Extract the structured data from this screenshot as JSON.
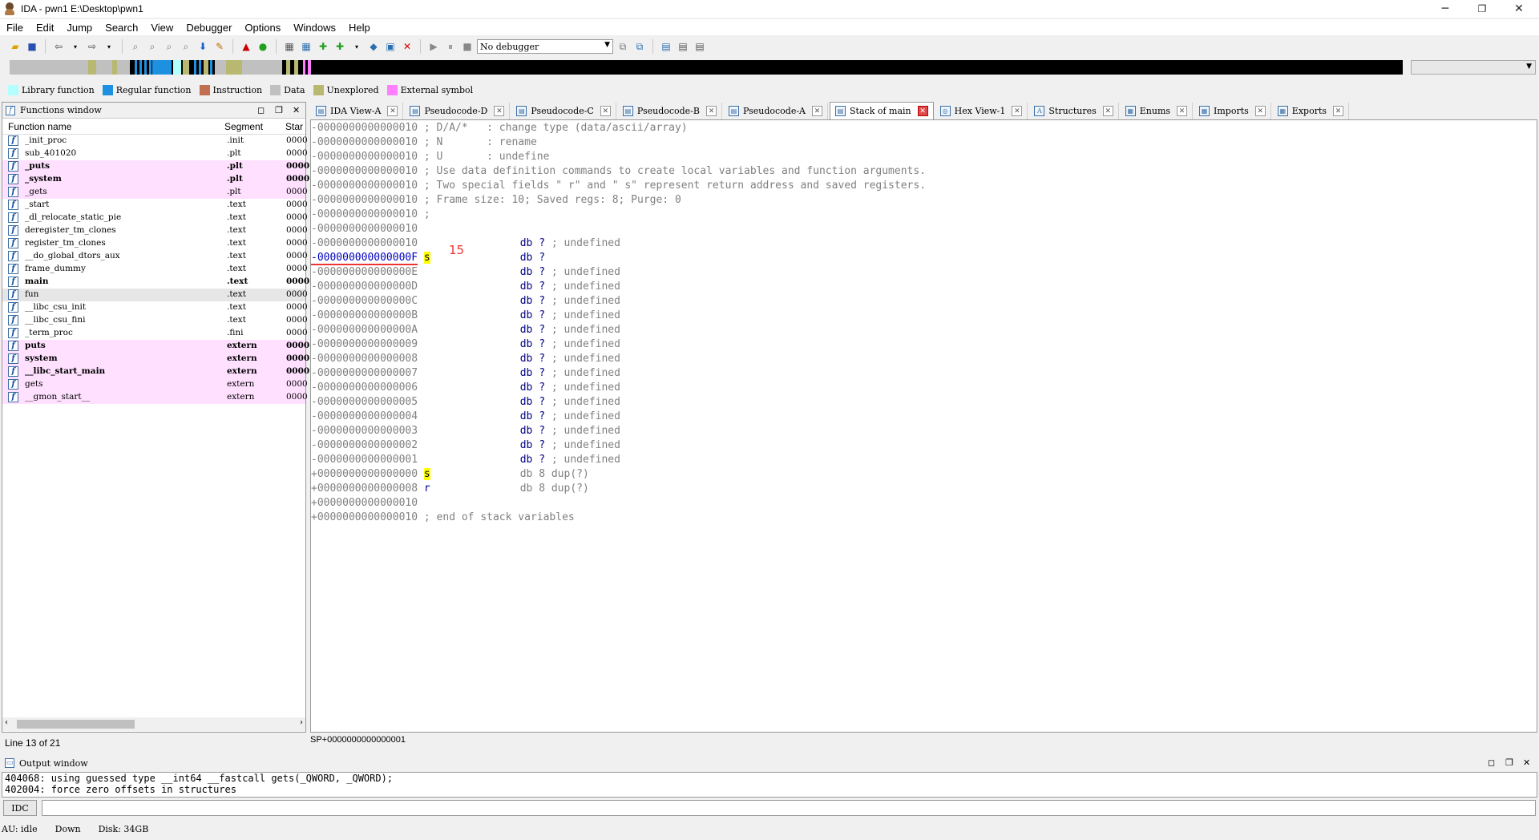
{
  "window": {
    "title": "IDA - pwn1 E:\\Desktop\\pwn1",
    "minimize": "─",
    "restore": "❐",
    "close": "✕"
  },
  "menu": [
    "File",
    "Edit",
    "Jump",
    "Search",
    "View",
    "Debugger",
    "Options",
    "Windows",
    "Help"
  ],
  "toolbar": {
    "debugger_value": "No debugger"
  },
  "legend": [
    {
      "label": "Library function",
      "color": "#b3ffff"
    },
    {
      "label": "Regular function",
      "color": "#1e90e0"
    },
    {
      "label": "Instruction",
      "color": "#c07050"
    },
    {
      "label": "Data",
      "color": "#c0c0c0"
    },
    {
      "label": "Unexplored",
      "color": "#b8b870"
    },
    {
      "label": "External symbol",
      "color": "#ff80ff"
    }
  ],
  "functions_window": {
    "title": "Functions window",
    "columns": [
      "Function name",
      "Segment",
      "Star"
    ],
    "rows": [
      {
        "name": "_init_proc",
        "segment": ".init",
        "start": "0000",
        "style": ""
      },
      {
        "name": "sub_401020",
        "segment": ".plt",
        "start": "0000",
        "style": ""
      },
      {
        "name": "_puts",
        "segment": ".plt",
        "start": "0000",
        "style": "pink bold"
      },
      {
        "name": "_system",
        "segment": ".plt",
        "start": "0000",
        "style": "pink bold"
      },
      {
        "name": "_gets",
        "segment": ".plt",
        "start": "0000",
        "style": "pink"
      },
      {
        "name": "_start",
        "segment": ".text",
        "start": "0000",
        "style": ""
      },
      {
        "name": "_dl_relocate_static_pie",
        "segment": ".text",
        "start": "0000",
        "style": ""
      },
      {
        "name": "deregister_tm_clones",
        "segment": ".text",
        "start": "0000",
        "style": ""
      },
      {
        "name": "register_tm_clones",
        "segment": ".text",
        "start": "0000",
        "style": ""
      },
      {
        "name": "__do_global_dtors_aux",
        "segment": ".text",
        "start": "0000",
        "style": ""
      },
      {
        "name": "frame_dummy",
        "segment": ".text",
        "start": "0000",
        "style": ""
      },
      {
        "name": "main",
        "segment": ".text",
        "start": "0000",
        "style": "bold"
      },
      {
        "name": "fun",
        "segment": ".text",
        "start": "0000",
        "style": "sel"
      },
      {
        "name": "__libc_csu_init",
        "segment": ".text",
        "start": "0000",
        "style": ""
      },
      {
        "name": "__libc_csu_fini",
        "segment": ".text",
        "start": "0000",
        "style": ""
      },
      {
        "name": "_term_proc",
        "segment": ".fini",
        "start": "0000",
        "style": ""
      },
      {
        "name": "puts",
        "segment": "extern",
        "start": "0000",
        "style": "pink bold"
      },
      {
        "name": "system",
        "segment": "extern",
        "start": "0000",
        "style": "pink bold"
      },
      {
        "name": "__libc_start_main",
        "segment": "extern",
        "start": "0000",
        "style": "pink bold"
      },
      {
        "name": "gets",
        "segment": "extern",
        "start": "0000",
        "style": "pink"
      },
      {
        "name": "__gmon_start__",
        "segment": "extern",
        "start": "0000",
        "style": "pink"
      }
    ],
    "status": "Line 13 of 21"
  },
  "tabs": [
    {
      "label": "IDA View-A",
      "active": false
    },
    {
      "label": "Pseudocode-D",
      "active": false
    },
    {
      "label": "Pseudocode-C",
      "active": false
    },
    {
      "label": "Pseudocode-B",
      "active": false
    },
    {
      "label": "Pseudocode-A",
      "active": false
    },
    {
      "label": "Stack of main",
      "active": true
    },
    {
      "label": "Hex View-1",
      "active": false
    },
    {
      "label": "Structures",
      "active": false
    },
    {
      "label": "Enums",
      "active": false
    },
    {
      "label": "Imports",
      "active": false
    },
    {
      "label": "Exports",
      "active": false
    }
  ],
  "stack_lines": [
    {
      "addr": "-0000000000000010",
      "text": " ; D/A/*   : change type (data/ascii/array)"
    },
    {
      "addr": "-0000000000000010",
      "text": " ; N       : rename"
    },
    {
      "addr": "-0000000000000010",
      "text": " ; U       : undefine"
    },
    {
      "addr": "-0000000000000010",
      "text": " ; Use data definition commands to create local variables and function arguments."
    },
    {
      "addr": "-0000000000000010",
      "text": " ; Two special fields \" r\" and \" s\" represent return address and saved registers."
    },
    {
      "addr": "-0000000000000010",
      "text": " ; Frame size: 10; Saved regs: 8; Purge: 0"
    },
    {
      "addr": "-0000000000000010",
      "text": " ;"
    },
    {
      "addr": "-0000000000000010",
      "text": ""
    },
    {
      "addr": "-0000000000000010",
      "name": "",
      "db": "db ?",
      "cmt": " ; undefined"
    },
    {
      "addr": "-000000000000000F",
      "name": "s",
      "db": "db ?",
      "cmt": "",
      "selected": true
    },
    {
      "addr": "-000000000000000E",
      "name": "",
      "db": "db ?",
      "cmt": " ; undefined"
    },
    {
      "addr": "-000000000000000D",
      "name": "",
      "db": "db ?",
      "cmt": " ; undefined"
    },
    {
      "addr": "-000000000000000C",
      "name": "",
      "db": "db ?",
      "cmt": " ; undefined"
    },
    {
      "addr": "-000000000000000B",
      "name": "",
      "db": "db ?",
      "cmt": " ; undefined"
    },
    {
      "addr": "-000000000000000A",
      "name": "",
      "db": "db ?",
      "cmt": " ; undefined"
    },
    {
      "addr": "-0000000000000009",
      "name": "",
      "db": "db ?",
      "cmt": " ; undefined"
    },
    {
      "addr": "-0000000000000008",
      "name": "",
      "db": "db ?",
      "cmt": " ; undefined"
    },
    {
      "addr": "-0000000000000007",
      "name": "",
      "db": "db ?",
      "cmt": " ; undefined"
    },
    {
      "addr": "-0000000000000006",
      "name": "",
      "db": "db ?",
      "cmt": " ; undefined"
    },
    {
      "addr": "-0000000000000005",
      "name": "",
      "db": "db ?",
      "cmt": " ; undefined"
    },
    {
      "addr": "-0000000000000004",
      "name": "",
      "db": "db ?",
      "cmt": " ; undefined"
    },
    {
      "addr": "-0000000000000003",
      "name": "",
      "db": "db ?",
      "cmt": " ; undefined"
    },
    {
      "addr": "-0000000000000002",
      "name": "",
      "db": "db ?",
      "cmt": " ; undefined"
    },
    {
      "addr": "-0000000000000001",
      "name": "",
      "db": "db ?",
      "cmt": " ; undefined"
    },
    {
      "addr": "+0000000000000000",
      "name": "s",
      "db": "db 8 dup(?)",
      "cmt": ""
    },
    {
      "addr": "+0000000000000008",
      "name": "r",
      "db": "db 8 dup(?)",
      "cmt": ""
    },
    {
      "addr": "+0000000000000010",
      "text": ""
    },
    {
      "addr": "+0000000000000010",
      "text": " ; end of stack variables"
    }
  ],
  "annotation_15": "15",
  "sp_status": "SP+0000000000000001",
  "output_window": {
    "title": "Output window",
    "lines": [
      "404068: using guessed type __int64 __fastcall gets(_QWORD, _QWORD);",
      "402004: force zero offsets in structures"
    ],
    "idc_label": "IDC"
  },
  "statusbar": {
    "au": "AU:  idle",
    "dir": "Down",
    "disk": "Disk: 34GB"
  }
}
